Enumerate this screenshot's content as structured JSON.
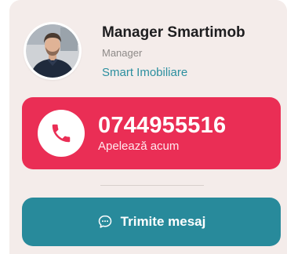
{
  "agent": {
    "name": "Manager Smartimob",
    "role": "Manager",
    "company": "Smart Imobiliare",
    "avatar_icon": "agent-photo"
  },
  "call": {
    "number": "0744955516",
    "subtitle": "Apelează acum",
    "icon": "phone-icon",
    "color": "#ea2e55"
  },
  "message": {
    "label": "Trimite mesaj",
    "icon": "chat-bubble-icon",
    "color": "#288a9b"
  },
  "colors": {
    "card_background": "#f4ecea",
    "accent_teal": "#2b8f9f"
  }
}
